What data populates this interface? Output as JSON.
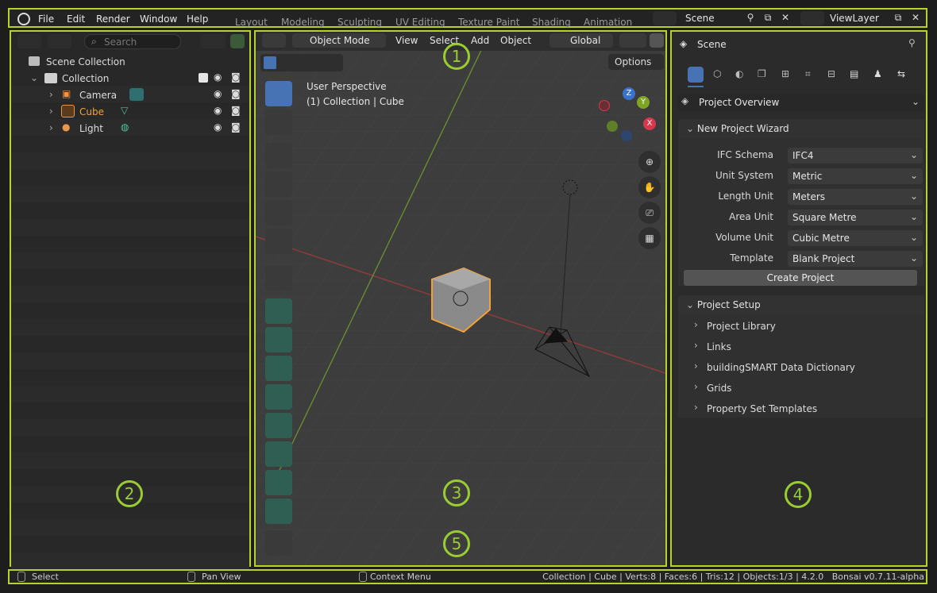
{
  "topbar": {
    "menus": [
      "File",
      "Edit",
      "Render",
      "Window",
      "Help"
    ],
    "workspaces": [
      "Layout",
      "Modeling",
      "Sculpting",
      "UV Editing",
      "Texture Paint",
      "Shading",
      "Animation"
    ],
    "scene_label": "Scene",
    "viewlayer_label": "ViewLayer"
  },
  "outliner": {
    "search_placeholder": "Search",
    "root": "Scene Collection",
    "collection": "Collection",
    "items": [
      {
        "name": "Camera",
        "color": "#e6e6e6"
      },
      {
        "name": "Cube",
        "color": "#f0a23a"
      },
      {
        "name": "Light",
        "color": "#e6e6e6"
      }
    ]
  },
  "viewport": {
    "mode": "Object Mode",
    "menus": [
      "View",
      "Select",
      "Add",
      "Object"
    ],
    "transform": "Global",
    "options": "Options",
    "perspective": "User Perspective",
    "context": "(1) Collection | Cube",
    "gizmo": {
      "z": "Z",
      "y": "Y",
      "x": "X"
    }
  },
  "properties": {
    "scene": "Scene",
    "overview": "Project Overview",
    "wizard_title": "New Project Wizard",
    "fields": [
      {
        "label": "IFC Schema",
        "value": "IFC4"
      },
      {
        "label": "Unit System",
        "value": "Metric"
      },
      {
        "label": "Length Unit",
        "value": "Meters"
      },
      {
        "label": "Area Unit",
        "value": "Square Metre"
      },
      {
        "label": "Volume Unit",
        "value": "Cubic Metre"
      },
      {
        "label": "Template",
        "value": "Blank Project"
      }
    ],
    "create_button": "Create Project",
    "setup_title": "Project Setup",
    "setup_items": [
      "Project Library",
      "Links",
      "buildingSMART Data Dictionary",
      "Grids",
      "Property Set Templates"
    ]
  },
  "status": {
    "select": "Select",
    "pan": "Pan View",
    "context_menu": "Context Menu",
    "info": "Collection | Cube | Verts:8 | Faces:6 | Tris:12 | Objects:1/3 | 4.2.0   Bonsai v0.7.11-alpha"
  },
  "badges": [
    "1",
    "2",
    "3",
    "4",
    "5"
  ],
  "colors": {
    "highlight": "#b8d12b",
    "accent": "#4772b3",
    "cube_orange": "#f0a23a"
  }
}
